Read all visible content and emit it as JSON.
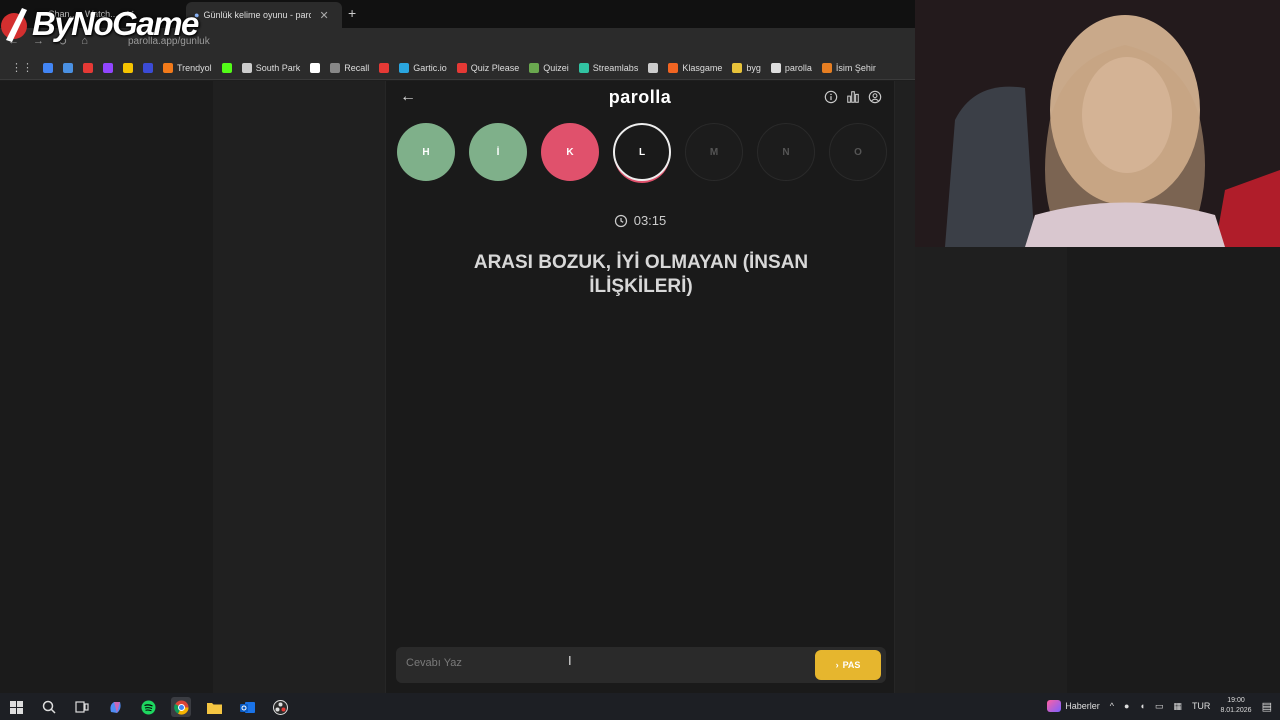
{
  "browser": {
    "tabs": [
      {
        "title": "Chan... - Watch...",
        "active": false
      },
      {
        "title": "Günlük kelime oyunu - paro",
        "active": true
      }
    ],
    "address": "parolla.app/gunluk",
    "bookmarks": [
      {
        "label": "",
        "icon": "google-icon",
        "color": "#4285f4"
      },
      {
        "label": "",
        "icon": "translate-icon",
        "color": "#4a90e2"
      },
      {
        "label": "",
        "icon": "youtube-icon",
        "color": "#e53935"
      },
      {
        "label": "",
        "icon": "twitch-icon",
        "color": "#9146ff"
      },
      {
        "label": "",
        "icon": "mail-icon",
        "color": "#f5c400"
      },
      {
        "label": "",
        "icon": "app-icon",
        "color": "#3b4bd6"
      },
      {
        "label": "Trendyol",
        "icon": "trendyol-icon",
        "color": "#f27a1a"
      },
      {
        "label": "",
        "icon": "kick-icon",
        "color": "#53fc18"
      },
      {
        "label": "South Park",
        "icon": "globe-icon",
        "color": "#cccccc"
      },
      {
        "label": "",
        "icon": "x-icon",
        "color": "#ffffff"
      },
      {
        "label": "Recall",
        "icon": "recall-icon",
        "color": "#888888"
      },
      {
        "label": "",
        "icon": "youtube-icon",
        "color": "#e53935"
      },
      {
        "label": "Gartic.io",
        "icon": "gartic-icon",
        "color": "#2aa6e0"
      },
      {
        "label": "Quiz Please",
        "icon": "youtube-icon",
        "color": "#e53935"
      },
      {
        "label": "Quizei",
        "icon": "quizei-icon",
        "color": "#6aa84f"
      },
      {
        "label": "Streamlabs",
        "icon": "streamlabs-icon",
        "color": "#31c3a2"
      },
      {
        "label": "",
        "icon": "globe-icon",
        "color": "#cccccc"
      },
      {
        "label": "Klasgame",
        "icon": "klasgame-icon",
        "color": "#f26522"
      },
      {
        "label": "byg",
        "icon": "byg-icon",
        "color": "#e8c33a"
      },
      {
        "label": "parolla",
        "icon": "parolla-icon",
        "color": "#dddddd"
      },
      {
        "label": "İsim Şehir",
        "icon": "isim-icon",
        "color": "#e67e22"
      }
    ]
  },
  "overlay": {
    "logo": "ByNoGame"
  },
  "game": {
    "title": "parolla",
    "letters": [
      {
        "letter": "H",
        "state": "correct",
        "color": "#7fb08a"
      },
      {
        "letter": "İ",
        "state": "correct",
        "color": "#7fb08a"
      },
      {
        "letter": "K",
        "state": "wrong",
        "color": "#e0516c"
      },
      {
        "letter": "L",
        "state": "current",
        "color": "#ffffff"
      },
      {
        "letter": "M",
        "state": "future",
        "color": "#555555"
      },
      {
        "letter": "N",
        "state": "future",
        "color": "#555555"
      },
      {
        "letter": "O",
        "state": "future",
        "color": "#555555"
      }
    ],
    "timer": "03:15",
    "question": "ARASI BOZUK, İYİ OLMAYAN (İNSAN İLİŞKİLERİ)",
    "answer_placeholder": "Cevabı Yaz",
    "pass_label": "PAS"
  },
  "taskbar": {
    "news": "Haberler",
    "lang": "TUR",
    "time": "19:00",
    "date": "8.01.2026"
  }
}
